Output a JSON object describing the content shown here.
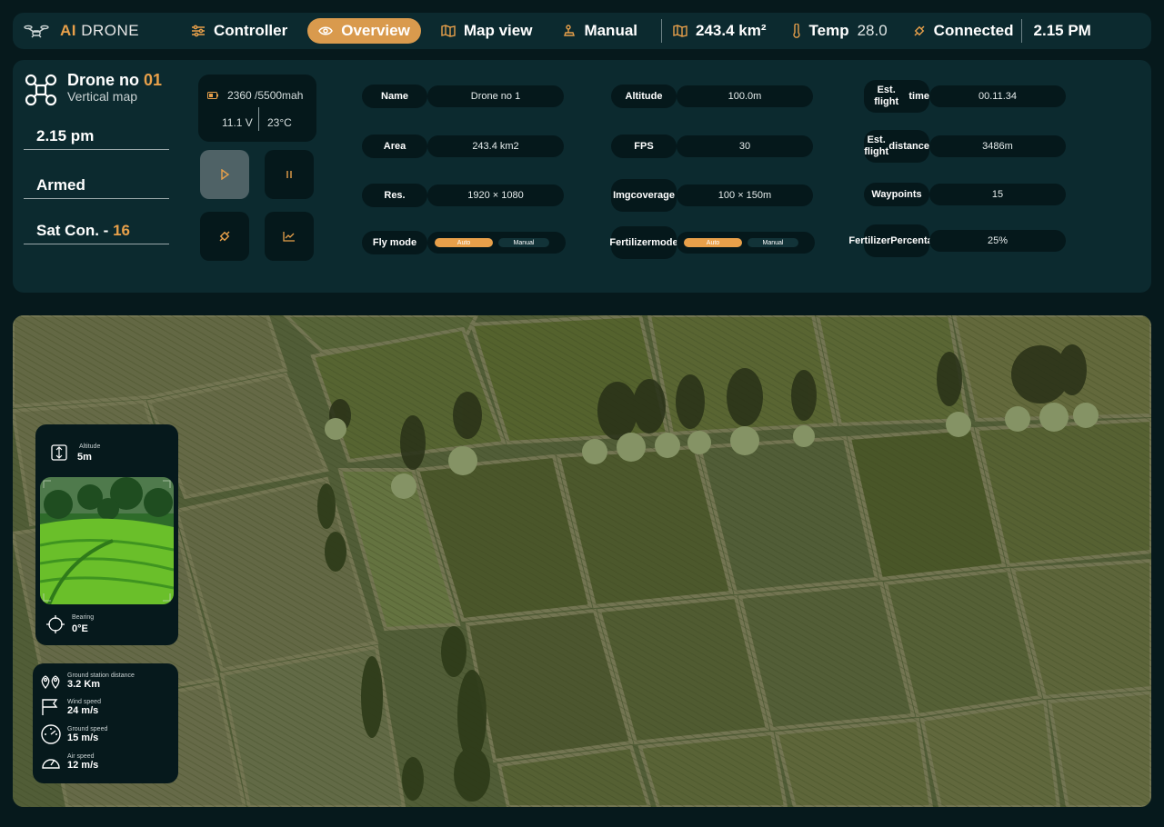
{
  "app": {
    "logo_ai": "AI",
    "logo_rest": "DRONE",
    "logo_icon": "drone-icon"
  },
  "nav": [
    {
      "label": "Controller",
      "icon": "sliders-icon",
      "active": false
    },
    {
      "label": "Overview",
      "icon": "eye-icon",
      "active": true
    },
    {
      "label": "Map view",
      "icon": "map-icon",
      "active": false
    },
    {
      "label": "Manual",
      "icon": "joystick-icon",
      "active": false
    }
  ],
  "status": {
    "area": "243.4 km²",
    "temp_label": "Temp",
    "temp_value": "28.0",
    "connection": "Connected",
    "time": "2.15 PM"
  },
  "drone": {
    "title": "Drone no",
    "number": "01",
    "subtitle": "Vertical map",
    "time": "2.15 pm",
    "state": "Armed",
    "sat_label": "Sat Con. -",
    "sat_value": "16"
  },
  "battery": {
    "capacity": "2360 /5500mah",
    "voltage": "11.1 V",
    "temperature": "23°C"
  },
  "details": {
    "name_label": "Name",
    "name_value": "Drone no 1",
    "area_label": "Area",
    "area_value": "243.4 km2",
    "res_label": "Res.",
    "res_value": "1920 × 1080",
    "flymode_label": "Fly mode",
    "flymode_on": "Auto",
    "flymode_off": "Manual",
    "altitude_label": "Altitude",
    "altitude_value": "100.0m",
    "fps_label": "FPS",
    "fps_value": "30",
    "img_label_1": "Img",
    "img_label_2": "coverage",
    "img_value": "100 × 150m",
    "fert_mode_label_1": "Fertilizer",
    "fert_mode_label_2": "mode",
    "fert_mode_on": "Auto",
    "fert_mode_off": "Manual",
    "flight_time_label_1": "Est. flight",
    "flight_time_label_2": "time",
    "flight_time_value": "00.11.34",
    "flight_dist_label_1": "Est. flight",
    "flight_dist_label_2": "distance",
    "flight_dist_value": "3486m",
    "waypoints_label": "Waypoints",
    "waypoints_value": "15",
    "fert_pct_label_1": "Fertilizer",
    "fert_pct_label_2": "Percentage",
    "fert_pct_value": "25%"
  },
  "camera": {
    "altitude_label": "Altitude",
    "altitude_value": "5m",
    "bearing_label": "Bearing",
    "bearing_value": "0°E"
  },
  "telemetry": {
    "gs_distance_label": "Ground station distance",
    "gs_distance_value": "3.2 Km",
    "wind_label": "Wind speed",
    "wind_value": "24 m/s",
    "ground_speed_label": "Ground speed",
    "ground_speed_value": "15 m/s",
    "air_speed_label": "Air speed",
    "air_speed_value": "12 m/s"
  },
  "colors": {
    "accent": "#e8a04a",
    "panel": "#0c2a2f",
    "background": "#06191c"
  }
}
